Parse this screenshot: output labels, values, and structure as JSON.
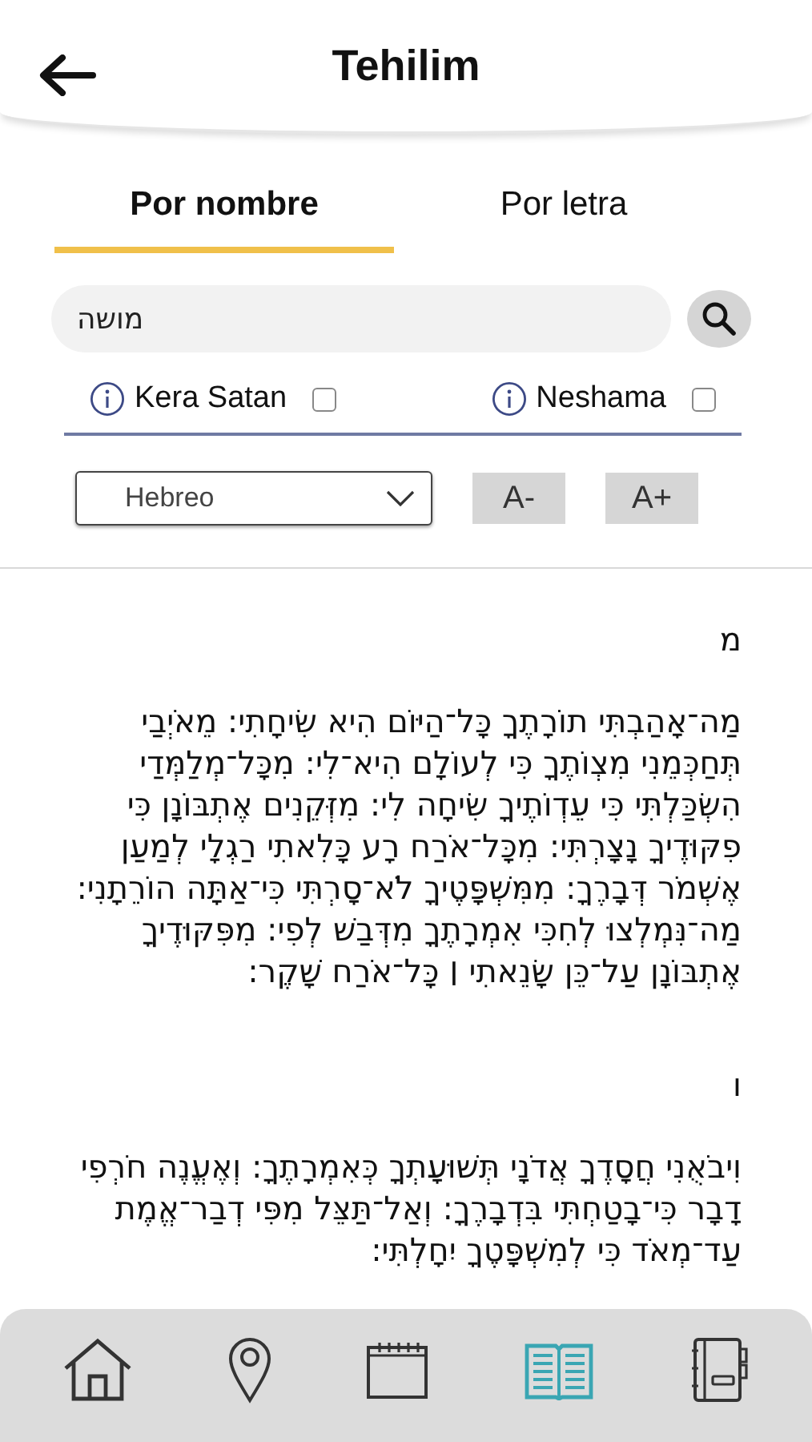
{
  "header": {
    "title": "Tehilim"
  },
  "tabs": {
    "by_name": {
      "label": "Por nombre",
      "selected": true
    },
    "by_letter": {
      "label": "Por letra",
      "selected": false
    }
  },
  "search": {
    "value": "מושה"
  },
  "options": {
    "kera_satan": {
      "label": "Kera Satan",
      "checked": false
    },
    "neshama": {
      "label": "Neshama",
      "checked": false
    }
  },
  "language_select": {
    "value": "Hebreo"
  },
  "font_buttons": {
    "decrease": "A-",
    "increase": "A+"
  },
  "sections": [
    {
      "letter": "מ",
      "text": "מַה־אָהַבְתִּי תוֹרָתֶךָ כָּל־הַיּוֹם הִיא שִׂיחָתִי: מֵאֹיְבַי תְּחַכְּמֵנִי מִצְוֺתֶךָ כִּי לְעוֹלָם הִיא־לִי: מִכָּל־מְלַמְּדַי הִשְׂכַּלְתִּי כִּי עֵדְוֺתֶיךָ שִׂיחָה לִי: מִזְּקֵנִים אֶתְבּוֹנָן כִּי פִקּוּדֶיךָ נָצָרְתִּי: מִכָּל־אֹרַח רָע כָּלִאתִי רַגְלָי לְמַעַן אֶשְׁמֹר דְּבָרֶךָ: מִמִּשְׁפָּטֶיךָ לֹא־סָרְתִּי כִּי־אַתָּה הוֹרֵתָנִי: מַה־נִּמְלְצוּ לְחִכִּי אִמְרָתֶךָ מִדְּבַשׁ לְפִי: מִפִּקּוּדֶיךָ אֶתְבּוֹנָן עַל־כֵּן שָׂנֵאתִי ׀ כָּל־אֹרַח שָׁקֶר:"
    },
    {
      "letter": "ו",
      "text": "וִיבֹאֻנִי חֲסָדֶךָ אֲדֹנָי תְּשׁוּעָתְךָ כְּאִמְרָתֶךָ: וְאֶעֱנֶה חֹרְפִי דָבָר כִּי־בָטַחְתִּי בִּדְבָרֶךָ: וְאַל־תַּצֵּל מִפִּי דְבַר־אֱמֶת עַד־מְאֹד כִּי לְמִשְׁפָּטֶךָ יִחָלְתִּי:"
    }
  ],
  "bottom_nav": [
    {
      "kind": "home",
      "selected": false
    },
    {
      "kind": "pin",
      "selected": false
    },
    {
      "kind": "calendar",
      "selected": false
    },
    {
      "kind": "book",
      "selected": true
    },
    {
      "kind": "notebook",
      "selected": false
    }
  ]
}
